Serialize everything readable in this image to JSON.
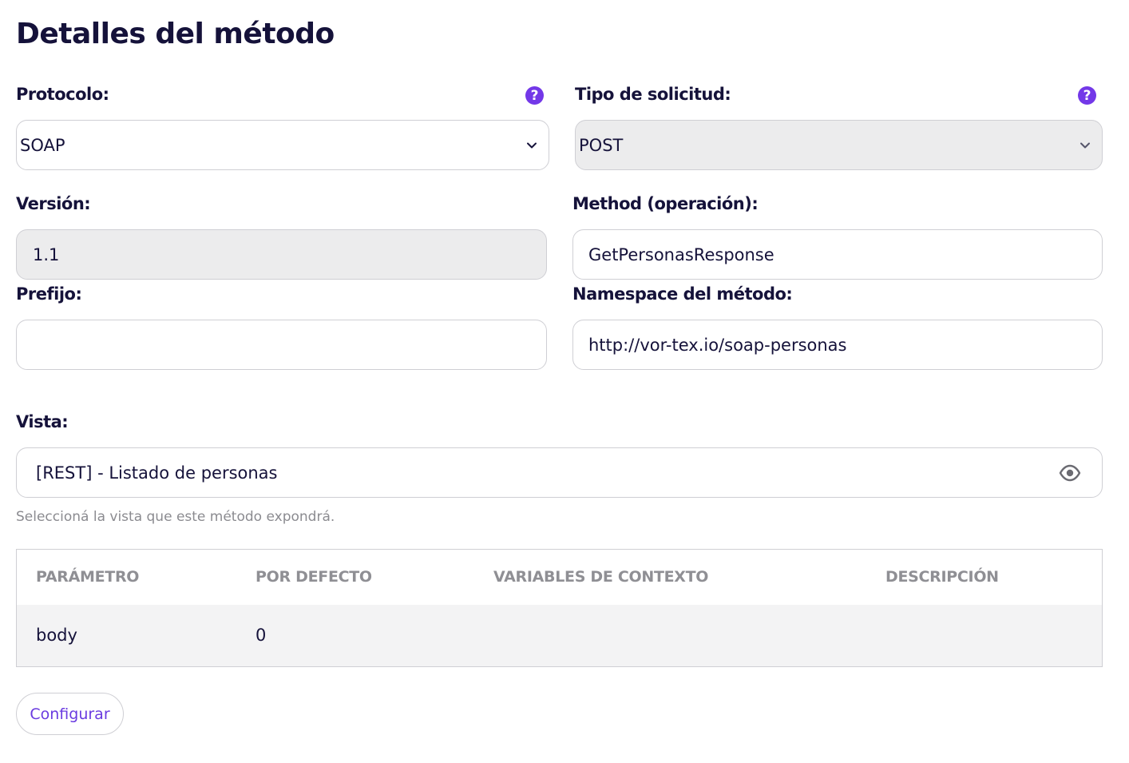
{
  "page": {
    "title": "Detalles del método"
  },
  "form": {
    "protocol": {
      "label": "Protocolo:",
      "value": "SOAP",
      "help": "?"
    },
    "request_type": {
      "label": "Tipo de solicitud:",
      "value": "POST",
      "help": "?"
    },
    "version": {
      "label": "Versión:",
      "value": "1.1"
    },
    "method": {
      "label": "Method (operación):",
      "value": "GetPersonasResponse"
    },
    "prefix": {
      "label": "Prefijo:",
      "value": ""
    },
    "namespace": {
      "label": "Namespace del método:",
      "value": "http://vor-tex.io/soap-personas"
    },
    "view": {
      "label": "Vista:",
      "value": "[REST] - Listado de personas",
      "hint": "Seleccioná la vista que este método expondrá."
    }
  },
  "params_table": {
    "headers": [
      "PARÁMETRO",
      "POR DEFECTO",
      "VARIABLES DE CONTEXTO",
      "DESCRIPCIÓN"
    ],
    "rows": [
      {
        "param": "body",
        "default": "0",
        "context": "",
        "description": ""
      }
    ]
  },
  "actions": {
    "configure_label": "Configurar"
  },
  "colors": {
    "accent": "#7338e8",
    "text": "#15123a",
    "muted": "#8f8f94",
    "disabled_bg": "#ececed"
  },
  "icons": {
    "help": "question-circle-icon",
    "select": "chevron-down-icon",
    "preview": "eye-icon"
  }
}
